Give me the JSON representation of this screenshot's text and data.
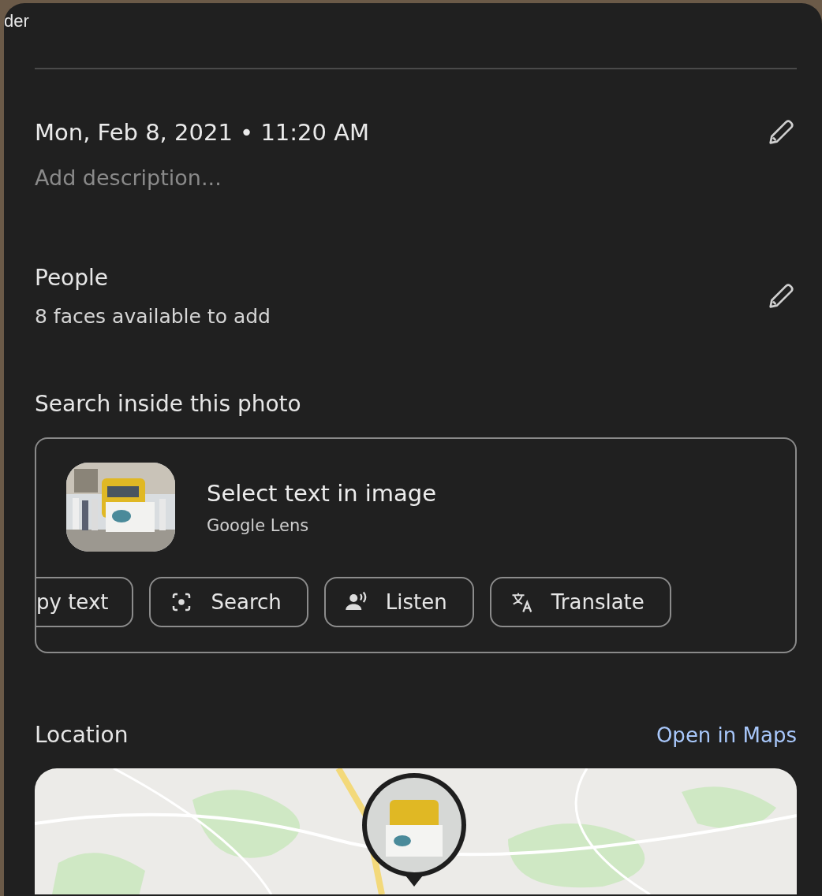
{
  "header_fragment": "der",
  "date_time": "Mon, Feb 8, 2021 • 11:20 AM",
  "description": {
    "placeholder": "Add description..."
  },
  "people": {
    "title": "People",
    "subtitle": "8 faces available to add"
  },
  "search_inside": {
    "title": "Search inside this photo",
    "card": {
      "title": "Select text in image",
      "subtitle": "Google Lens",
      "actions": [
        {
          "kind": "cut",
          "label": "py text"
        },
        {
          "kind": "search",
          "label": "Search"
        },
        {
          "kind": "listen",
          "label": "Listen"
        },
        {
          "kind": "translate",
          "label": "Translate"
        }
      ]
    }
  },
  "location": {
    "title": "Location",
    "link": "Open in Maps"
  }
}
